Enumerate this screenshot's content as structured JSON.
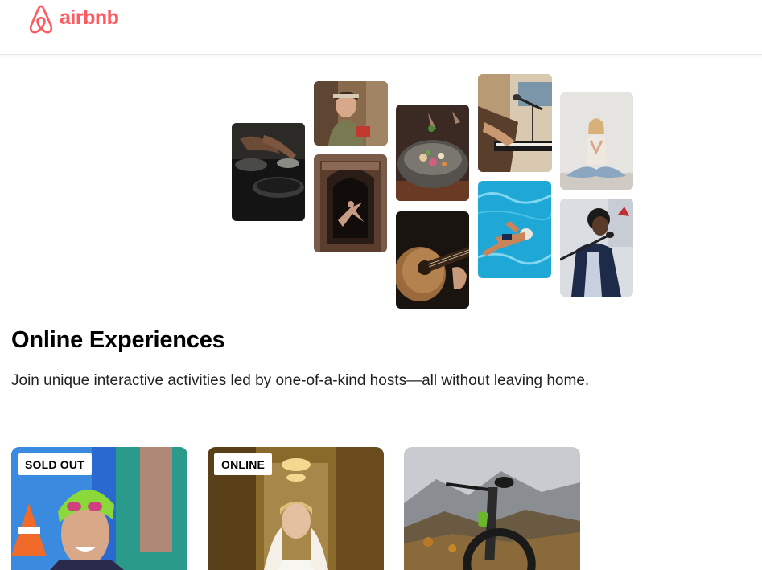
{
  "header": {
    "brand": "airbnb",
    "logo_icon": "airbnb-belo-icon",
    "brand_color": "#ff5a5f"
  },
  "mosaic": {
    "tiles": [
      {
        "name": "cooking-pan-photo",
        "subject": "cooking"
      },
      {
        "name": "cook-woman-photo",
        "subject": "cooking"
      },
      {
        "name": "dancer-doorway-photo",
        "subject": "dance"
      },
      {
        "name": "food-bowl-photo",
        "subject": "food"
      },
      {
        "name": "guitar-photo",
        "subject": "music"
      },
      {
        "name": "piano-singer-photo",
        "subject": "music"
      },
      {
        "name": "swimmer-photo",
        "subject": "swimming"
      },
      {
        "name": "yoga-photo",
        "subject": "yoga"
      },
      {
        "name": "singer-microphone-photo",
        "subject": "singing"
      }
    ]
  },
  "section": {
    "title": "Online Experiences",
    "subtitle": "Join unique interactive activities led by one-of-a-kind hosts—all without leaving home."
  },
  "cards": [
    {
      "badge": "SOLD OUT",
      "image": "swimmer-goggles-photo"
    },
    {
      "badge": "ONLINE",
      "image": "bride-veil-photo"
    },
    {
      "badge": "",
      "image": "mountain-bike-photo"
    }
  ],
  "colors": {
    "accent": "#ff5a5f",
    "text": "#222222",
    "pool_blue": "#1fa8d6"
  }
}
